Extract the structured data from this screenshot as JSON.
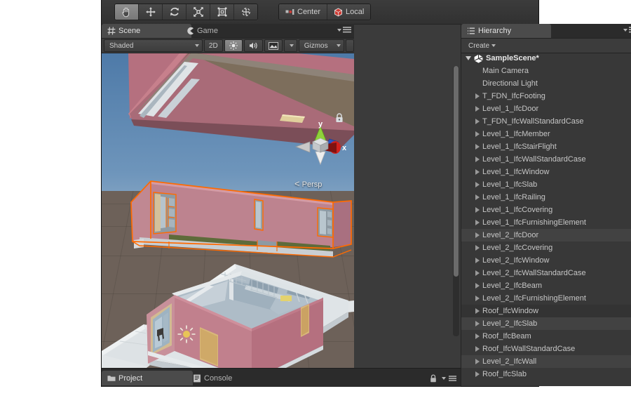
{
  "app": {
    "name": "Unity Editor"
  },
  "toolbar": {
    "transform_tools": [
      {
        "name": "hand-tool",
        "icon": "hand-icon",
        "active": true
      },
      {
        "name": "move-tool",
        "icon": "move-icon",
        "active": false
      },
      {
        "name": "rotate-tool",
        "icon": "rotate-icon",
        "active": false
      },
      {
        "name": "scale-tool",
        "icon": "scale-icon",
        "active": false
      },
      {
        "name": "rect-tool",
        "icon": "rect-transform-icon",
        "active": false
      },
      {
        "name": "transform-tool",
        "icon": "transform-icon",
        "active": false
      }
    ],
    "pivot_label": "Center",
    "space_label": "Local"
  },
  "scene_panel": {
    "tabs": [
      {
        "label": "Scene",
        "icon": "scene-grid-icon",
        "active": true
      },
      {
        "label": "Game",
        "icon": "game-pacman-icon",
        "active": false
      }
    ],
    "toolbar": {
      "draw_mode": "Shaded",
      "two_d_label": "2D",
      "lighting_icon": "sun-icon",
      "audio_icon": "speaker-icon",
      "fx_icon": "effects-icon",
      "gizmos_label": "Gizmos",
      "search_placeholder": ""
    },
    "viewport": {
      "perspective_label": "Persp",
      "axis_x_label": "x",
      "axis_y_label": "y",
      "lock_icon": "lock-icon",
      "light_gizmo_icon": "point-light-icon",
      "colors": {
        "sky_top": "#4e7aa8",
        "sky_bottom": "#d6dee5",
        "ground": "#6d6159",
        "wall_pink": "#c28a94",
        "wall_rose": "#b5707f",
        "roof_top": "#7d6e5c",
        "selection_outline": "#ff6a00",
        "slab_white": "#e4e8ea",
        "door_tan": "#d9b87a",
        "glass_blue": "#9fb6c6",
        "grass_green": "#5e6b3a"
      }
    }
  },
  "bottom_panel": {
    "tabs": [
      {
        "label": "Project",
        "icon": "folder-icon",
        "active": true
      },
      {
        "label": "Console",
        "icon": "console-icon",
        "active": false
      }
    ],
    "lock_icon": "lock-icon",
    "menu_icon": "hamburger-menu-icon"
  },
  "hierarchy": {
    "tab_label": "Hierarchy",
    "tab_icon": "hierarchy-list-icon",
    "create_label": "Create",
    "menu_icon": "hamburger-menu-icon",
    "scene_name": "SampleScene*",
    "items": [
      {
        "label": "Main Camera",
        "expandable": false,
        "row": "normal"
      },
      {
        "label": "Directional Light",
        "expandable": false,
        "row": "normal"
      },
      {
        "label": "T_FDN_IfcFooting",
        "expandable": true,
        "row": "normal"
      },
      {
        "label": "Level_1_IfcDoor",
        "expandable": true,
        "row": "normal"
      },
      {
        "label": "T_FDN_IfcWallStandardCase",
        "expandable": true,
        "row": "normal"
      },
      {
        "label": "Level_1_IfcMember",
        "expandable": true,
        "row": "normal"
      },
      {
        "label": "Level_1_IfcStairFlight",
        "expandable": true,
        "row": "normal"
      },
      {
        "label": "Level_1_IfcWallStandardCase",
        "expandable": true,
        "row": "normal"
      },
      {
        "label": "Level_1_IfcWindow",
        "expandable": true,
        "row": "normal"
      },
      {
        "label": "Level_1_IfcSlab",
        "expandable": true,
        "row": "normal"
      },
      {
        "label": "Level_1_IfcRailing",
        "expandable": true,
        "row": "normal"
      },
      {
        "label": "Level_1_IfcCovering",
        "expandable": true,
        "row": "normal"
      },
      {
        "label": "Level_1_IfcFurnishingElement",
        "expandable": true,
        "row": "normal"
      },
      {
        "label": "Level_2_IfcDoor",
        "expandable": true,
        "row": "alt"
      },
      {
        "label": "Level_2_IfcCovering",
        "expandable": true,
        "row": "normal"
      },
      {
        "label": "Level_2_IfcWindow",
        "expandable": true,
        "row": "normal"
      },
      {
        "label": "Level_2_IfcWallStandardCase",
        "expandable": true,
        "row": "normal"
      },
      {
        "label": "Level_2_IfcBeam",
        "expandable": true,
        "row": "normal"
      },
      {
        "label": "Level_2_IfcFurnishingElement",
        "expandable": true,
        "row": "normal"
      },
      {
        "label": "Roof_IfcWindow",
        "expandable": true,
        "row": "dark"
      },
      {
        "label": "Level_2_IfcSlab",
        "expandable": true,
        "row": "alt"
      },
      {
        "label": "Roof_IfcBeam",
        "expandable": true,
        "row": "normal"
      },
      {
        "label": "Roof_IfcWallStandardCase",
        "expandable": true,
        "row": "normal"
      },
      {
        "label": "Level_2_IfcWall",
        "expandable": true,
        "row": "alt"
      },
      {
        "label": "Roof_IfcSlab",
        "expandable": true,
        "row": "normal"
      }
    ]
  }
}
